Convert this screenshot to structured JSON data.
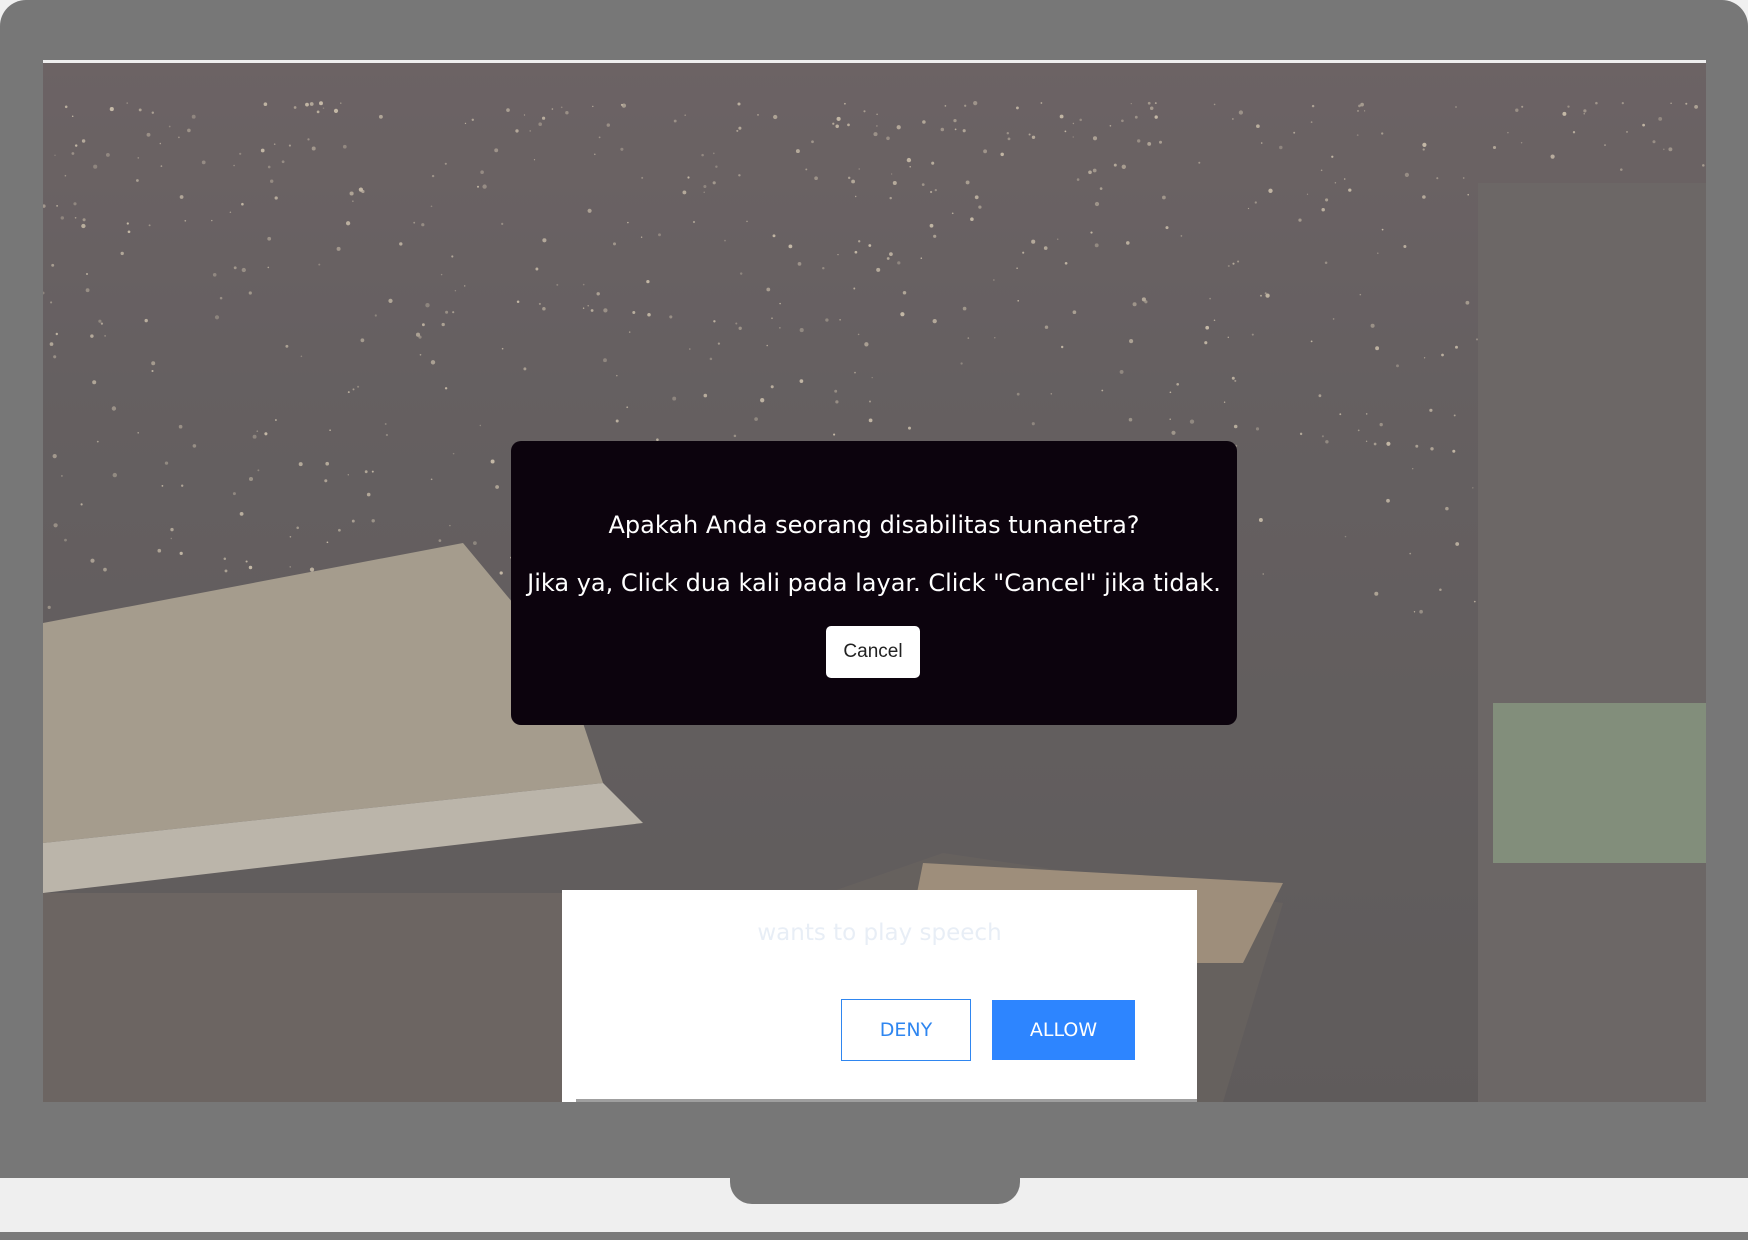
{
  "dialog": {
    "question": "Apakah Anda seorang disabilitas tunanetra?",
    "instruction": "Jika ya, Click dua kali pada layar. Click \"Cancel\" jika tidak.",
    "cancel_label": "Cancel"
  },
  "speech_permission": {
    "message": "wants to play speech",
    "deny_label": "DENY",
    "allow_label": "ALLOW"
  },
  "colors": {
    "frame": "#777777",
    "dialog_bg": "#0c030d",
    "allow_bg": "#2d85ff",
    "deny_border": "#2f86f0"
  }
}
